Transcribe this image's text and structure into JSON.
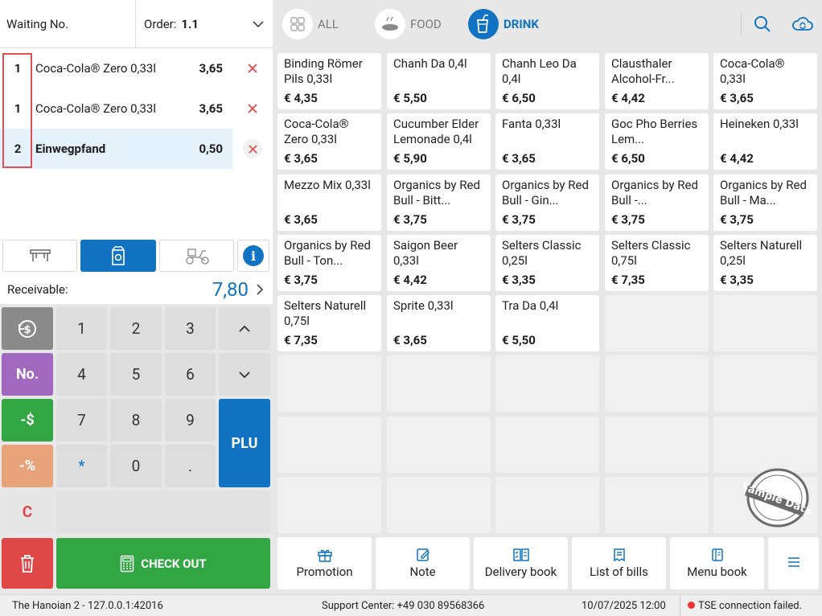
{
  "header": {
    "waiting_label": "Waiting No.",
    "order_label": "Order:",
    "order_value": "1.1"
  },
  "order_items": [
    {
      "qty": "1",
      "name": "Coca-Cola® Zero 0,33l",
      "price": "3,65"
    },
    {
      "qty": "1",
      "name": "Coca-Cola® Zero 0,33l",
      "price": "3,65"
    },
    {
      "qty": "2",
      "name": "Einwegpfand",
      "price": "0,50"
    }
  ],
  "receivable": {
    "label": "Receivable:",
    "value": "7,80"
  },
  "keypad": {
    "k1": "1",
    "k2": "2",
    "k3": "3",
    "k4": "4",
    "k5": "5",
    "k6": "6",
    "k7": "7",
    "k8": "8",
    "k9": "9",
    "k0": "0",
    "star": "*",
    "dot": ".",
    "no": "No.",
    "minus_money": "-$",
    "minus_percent": "-%",
    "clear": "C",
    "plu": "PLU",
    "checkout": "CHECK OUT"
  },
  "categories": [
    {
      "label": "ALL"
    },
    {
      "label": "FOOD"
    },
    {
      "label": "DRINK"
    }
  ],
  "products": [
    {
      "name": "Binding Römer Pils 0,33l",
      "price": "€ 4,35"
    },
    {
      "name": "Chanh Da 0,4l",
      "price": "€ 5,50"
    },
    {
      "name": "Chanh Leo Da 0,4l",
      "price": "€ 6,50"
    },
    {
      "name": "Clausthaler Alcohol-Fr...",
      "price": "€ 4,42"
    },
    {
      "name": "Coca-Cola® 0,33l",
      "price": "€ 3,65"
    },
    {
      "name": "Coca-Cola® Zero 0,33l",
      "price": "€ 3,65"
    },
    {
      "name": "Cucumber Elder Lemonade 0,4l",
      "price": "€ 5,90"
    },
    {
      "name": "Fanta 0,33l",
      "price": "€ 3,65"
    },
    {
      "name": "Goc Pho Berries Lem...",
      "price": "€ 6,50"
    },
    {
      "name": "Heineken 0,33l",
      "price": "€ 4,42"
    },
    {
      "name": "Mezzo Mix 0,33l",
      "price": "€ 3,65"
    },
    {
      "name": "Organics by Red Bull - Bitt...",
      "price": "€ 3,75"
    },
    {
      "name": "Organics by Red Bull - Gin...",
      "price": "€ 3,75"
    },
    {
      "name": "Organics by Red Bull -...",
      "price": "€ 3,75"
    },
    {
      "name": "Organics by Red Bull - Ma...",
      "price": "€ 3,75"
    },
    {
      "name": "Organics by Red Bull - Ton...",
      "price": "€ 3,75"
    },
    {
      "name": "Saigon Beer 0,33l",
      "price": "€ 4,42"
    },
    {
      "name": "Selters Classic 0,25l",
      "price": "€ 3,35"
    },
    {
      "name": "Selters Classic 0,75l",
      "price": "€ 7,35"
    },
    {
      "name": "Selters Naturell 0,25l",
      "price": "€ 3,35"
    },
    {
      "name": "Selters Naturell 0,75l",
      "price": "€ 7,35"
    },
    {
      "name": "Sprite 0,33l",
      "price": "€ 3,65"
    },
    {
      "name": "Tra Da 0,4l",
      "price": "€ 5,50"
    }
  ],
  "stamp_text": "Sample Data",
  "bottom_tabs": {
    "promotion": "Promotion",
    "note": "Note",
    "delivery": "Delivery book",
    "bills": "List of bills",
    "menu": "Menu book"
  },
  "status": {
    "host": "The Hanoian 2 - 127.0.0.1:42016",
    "support": "Support Center: +49 030 89568366",
    "datetime": "10/07/2025 12:00",
    "tse": "TSE connection failed."
  },
  "colors": {
    "accent": "#1173c1",
    "checkout": "#33a644",
    "danger": "#e04848",
    "no_key": "#a068bf",
    "percent_key": "#e9a37a"
  }
}
